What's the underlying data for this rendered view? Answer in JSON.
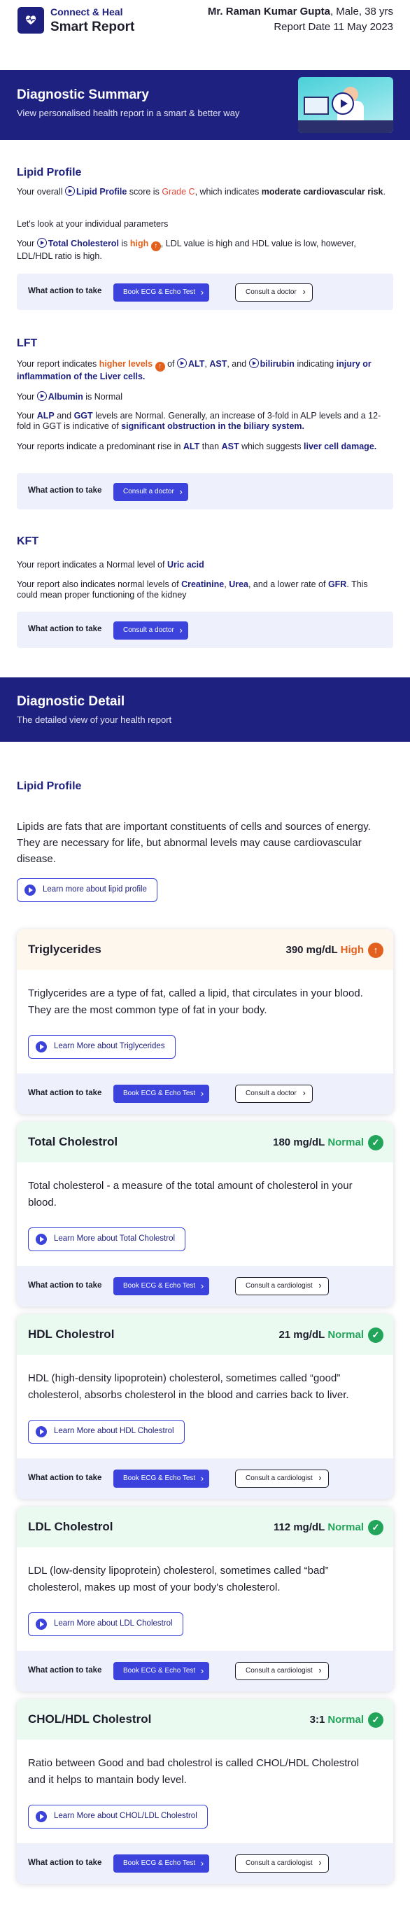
{
  "header": {
    "brand_line1": "Connect & Heal",
    "brand_line2": "Smart Report",
    "patient_name": "Mr. Raman Kumar Gupta",
    "patient_meta": ", Male, 38 yrs",
    "report_date": "Report Date 11 May 2023"
  },
  "summary_banner": {
    "title": "Diagnostic Summary",
    "subtitle": "View personalised health report in a smart & better way"
  },
  "lipid": {
    "title": "Lipid Profile",
    "p1_a": "Your overall",
    "p1_b": "Lipid Profile",
    "p1_c": "score is",
    "p1_grade": "Grade C",
    "p1_d": ", which indicates",
    "p1_e": "moderate cardiovascular risk",
    "p1_f": ".",
    "p2": "Let's look at your individual parameters",
    "p3_a": "Your",
    "p3_b": "Total Cholesterol",
    "p3_c": "is",
    "p3_high": "high",
    "p3_d": ", LDL value is high and HDL value is low, however, LDL/HDL ratio is high.",
    "action_label": "What action to take",
    "btn_ecg": "Book ECG & Echo Test",
    "btn_doctor": "Consult a doctor"
  },
  "lft": {
    "title": "LFT",
    "p1_a": "Your report indicates",
    "p1_high": "higher levels",
    "p1_b": "of",
    "p1_alt": "ALT",
    "p1_ast": "AST",
    "p1_c": ", and",
    "p1_bili": "bilirubin",
    "p1_d": "indicating",
    "p1_e": "injury or inflammation of the Liver cells.",
    "p2_a": "Your",
    "p2_b": "Albumin",
    "p2_c": "is Normal",
    "p3_a": "Your",
    "p3_alp": "ALP",
    "p3_b": "and",
    "p3_ggt": "GGT",
    "p3_c": "levels are Normal.  Generally, an increase of 3-fold in ALP levels and a 12-fold in GGT is indicative of",
    "p3_d": "significant obstruction in the biliary system.",
    "p4_a": "Your reports indicate a predominant rise in",
    "p4_alt": "ALT",
    "p4_b": "than",
    "p4_ast": "AST",
    "p4_c": "which suggests",
    "p4_d": "liver cell damage.",
    "action_label": "What action to take",
    "btn_doctor": "Consult a doctor"
  },
  "kft": {
    "title": "KFT",
    "p1_a": "Your report indicates a Normal level of",
    "p1_b": "Uric acid",
    "p2_a": "Your report also indicates normal levels of",
    "p2_crea": "Creatinine",
    "p2_urea": "Urea",
    "p2_b": ", and a lower rate of",
    "p2_gfr": "GFR",
    "p2_c": ". This could mean proper functioning of the kidney",
    "action_label": "What action to take",
    "btn_doctor": "Consult a doctor"
  },
  "detail_banner": {
    "title": "Diagnostic Detail",
    "subtitle": "The detailed view of your health report"
  },
  "detail": {
    "section_title": "Lipid Profile",
    "intro": "Lipids are fats that are important constituents of cells and sources of energy. They are necessary for life, but abnormal levels may cause cardiovascular disease.",
    "learn_lipid": "Learn more about lipid profile",
    "action_label": "What action to take",
    "cards": [
      {
        "title": "Triglycerides",
        "value": "390 mg/dL",
        "status": "High",
        "desc": "Triglycerides are a type of fat, called a lipid, that circulates in your blood. They are the most common type of fat in your body.",
        "learn": "Learn More about Triglycerides",
        "btn_ecg": "Book ECG & Echo Test",
        "btn_consult": "Consult a doctor"
      },
      {
        "title": "Total Cholestrol",
        "value": "180 mg/dL",
        "status": "Normal",
        "desc": "Total cholesterol - a measure of the total amount of cholesterol in your blood.",
        "learn": "Learn More about Total Cholestrol",
        "btn_ecg": "Book ECG & Echo Test",
        "btn_consult": "Consult a cardiologist"
      },
      {
        "title": "HDL Cholestrol",
        "value": "21 mg/dL",
        "status": "Normal",
        "desc": "HDL (high-density lipoprotein) cholesterol, sometimes called “good” cholesterol, absorbs cholesterol in the blood and carries back to liver.",
        "learn": "Learn More about HDL Cholestrol",
        "btn_ecg": "Book ECG & Echo Test",
        "btn_consult": "Consult a cardiologist"
      },
      {
        "title": "LDL Cholestrol",
        "value": "112 mg/dL",
        "status": "Normal",
        "desc": "LDL (low-density lipoprotein) cholesterol, sometimes called “bad” cholesterol, makes up most of your body's cholesterol.",
        "learn": "Learn More about LDL Cholestrol",
        "btn_ecg": "Book ECG & Echo Test",
        "btn_consult": "Consult a cardiologist"
      },
      {
        "title": "CHOL/HDL Cholestrol",
        "value": "3:1",
        "status": "Normal",
        "desc": "Ratio between Good and bad cholestrol is called CHOL/HDL Cholestrol and it helps to mantain body level.",
        "learn": "Learn More about CHOL/LDL Cholestrol",
        "btn_ecg": "Book ECG & Echo Test",
        "btn_consult": "Consult a cardiologist"
      }
    ]
  },
  "colors": {
    "navy": "#1f2180",
    "primary_button": "#3b43dc",
    "high": "#e2611f",
    "normal": "#22a55a",
    "grade": "#e04a3a"
  },
  "icons": {
    "logo": "heart-pulse-icon",
    "inline_link": "play-circle-icon",
    "high": "arrow-up-circle-icon",
    "normal": "check-circle-icon",
    "chevron": "chevron-right-icon"
  }
}
